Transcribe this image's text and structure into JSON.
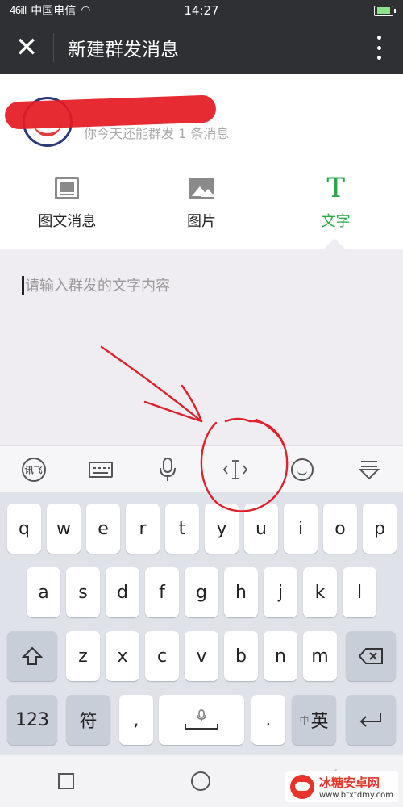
{
  "status": {
    "signal_text": "46ill",
    "carrier": "中国电信",
    "time": "14:27"
  },
  "header": {
    "title": "新建群发消息"
  },
  "account": {
    "quota_text": "你今天还能群发 1 条消息"
  },
  "message_types": [
    {
      "label": "图文消息",
      "icon": "news-icon"
    },
    {
      "label": "图片",
      "icon": "image-icon"
    },
    {
      "label": "文字",
      "icon": "text-icon",
      "active": true,
      "icon_char": "T"
    }
  ],
  "compose": {
    "placeholder": "请输入群发的文字内容"
  },
  "ime_toolbar": {
    "logo_text": "讯飞"
  },
  "keyboard": {
    "row1": [
      "q",
      "w",
      "e",
      "r",
      "t",
      "y",
      "u",
      "i",
      "o",
      "p"
    ],
    "row2": [
      "a",
      "s",
      "d",
      "f",
      "g",
      "h",
      "j",
      "k",
      "l"
    ],
    "row3": [
      "z",
      "x",
      "c",
      "v",
      "b",
      "n",
      "m"
    ],
    "numeric_label": "123",
    "symbol_label": "符",
    "period_label": ".",
    "lang_small": "中",
    "lang_label": "英"
  },
  "watermark": {
    "name": "冰糖安卓网",
    "url": "www.btxtdmy.com"
  },
  "colors": {
    "header_bg": "#2f3033",
    "active_green": "#28a745",
    "annotation_red": "#e0202a"
  }
}
